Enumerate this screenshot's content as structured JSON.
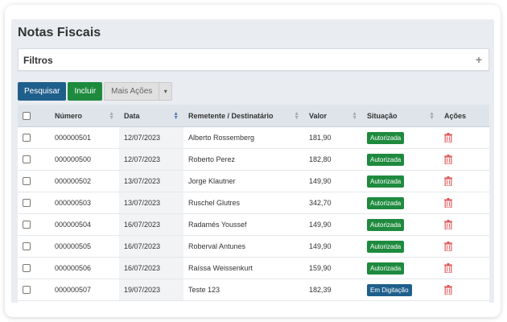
{
  "page_title": "Notas Fiscais",
  "filters": {
    "label": "Filtros",
    "toggle": "+"
  },
  "toolbar": {
    "search_label": "Pesquisar",
    "add_label": "Incluir",
    "more_label": "Mais Ações",
    "caret": "▾"
  },
  "table": {
    "headers": [
      "Número",
      "Data",
      "Remetente / Destinatário",
      "Valor",
      "Situação",
      "Ações"
    ],
    "rows": [
      {
        "numero": "000000501",
        "data": "12/07/2023",
        "remetente": "Alberto Rossemberg",
        "valor": "181,90",
        "situacao": "Autorizada"
      },
      {
        "numero": "000000500",
        "data": "12/07/2023",
        "remetente": "Roberto Perez",
        "valor": "182,80",
        "situacao": "Autorizada"
      },
      {
        "numero": "000000502",
        "data": "13/07/2023",
        "remetente": "Jorge Klautner",
        "valor": "149,90",
        "situacao": "Autorizada"
      },
      {
        "numero": "000000503",
        "data": "13/07/2023",
        "remetente": "Ruschel Glutres",
        "valor": "342,70",
        "situacao": "Autorizada"
      },
      {
        "numero": "000000504",
        "data": "16/07/2023",
        "remetente": "Radamés Youssef",
        "valor": "149,90",
        "situacao": "Autorizada"
      },
      {
        "numero": "000000505",
        "data": "16/07/2023",
        "remetente": "Roberval Antunes",
        "valor": "149,90",
        "situacao": "Autorizada"
      },
      {
        "numero": "000000506",
        "data": "16/07/2023",
        "remetente": "Raíssa Weissenkurt",
        "valor": "159,90",
        "situacao": "Autorizada"
      },
      {
        "numero": "000000507",
        "data": "19/07/2023",
        "remetente": "Teste 123",
        "valor": "182,39",
        "situacao": "Em Digitação"
      }
    ]
  },
  "colors": {
    "primary": "#1f5f8b",
    "success": "#1e8a3e",
    "danger": "#e05a5a"
  }
}
